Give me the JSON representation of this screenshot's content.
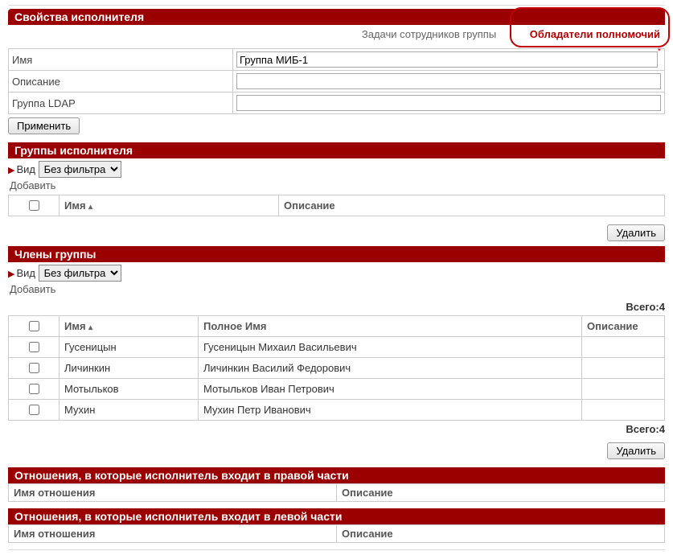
{
  "sections": {
    "executor_props": {
      "title": "Свойства исполнителя",
      "links": {
        "tasks": "Задачи сотрудников группы",
        "holders": "Обладатели полномочий"
      },
      "fields": {
        "name_label": "Имя",
        "name_value": "Группа МИБ-1",
        "desc_label": "Описание",
        "desc_value": "",
        "ldap_label": "Группа LDAP",
        "ldap_value": ""
      },
      "apply": "Применить"
    },
    "executor_groups": {
      "title": "Группы исполнителя",
      "filter_label": "Вид",
      "filter_value": "Без фильтра",
      "add": "Добавить",
      "columns": {
        "name": "Имя",
        "desc": "Описание"
      },
      "delete": "Удалить"
    },
    "group_members": {
      "title": "Члены группы",
      "filter_label": "Вид",
      "filter_value": "Без фильтра",
      "add": "Добавить",
      "total_label": "Всего:",
      "total_count": 4,
      "columns": {
        "name": "Имя",
        "fullname": "Полное Имя",
        "desc": "Описание"
      },
      "rows": [
        {
          "name": "Гусеницын",
          "fullname": "Гусеницын Михаил Васильевич",
          "desc": ""
        },
        {
          "name": "Личинкин",
          "fullname": "Личинкин Василий Федорович",
          "desc": ""
        },
        {
          "name": "Мотыльков",
          "fullname": "Мотыльков Иван Петрович",
          "desc": ""
        },
        {
          "name": "Мухин",
          "fullname": "Мухин Петр Иванович",
          "desc": ""
        }
      ],
      "delete": "Удалить"
    },
    "relations_right": {
      "title": "Отношения, в которые исполнитель входит в правой части",
      "columns": {
        "name": "Имя отношения",
        "desc": "Описание"
      }
    },
    "relations_left": {
      "title": "Отношения, в которые исполнитель входит в левой части",
      "columns": {
        "name": "Имя отношения",
        "desc": "Описание"
      }
    }
  }
}
